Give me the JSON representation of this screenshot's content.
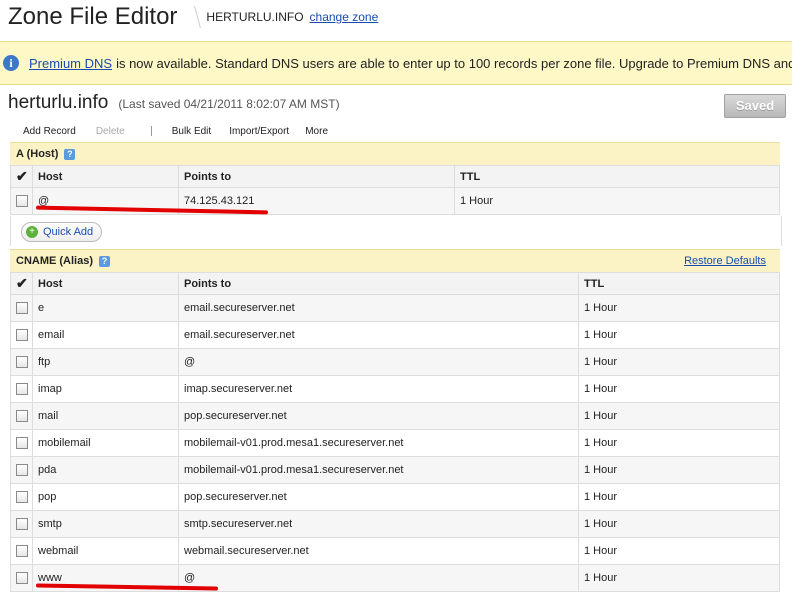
{
  "header": {
    "title": "Zone File Editor",
    "zone": "HERTURLU.INFO",
    "change_zone": "change zone"
  },
  "banner": {
    "link": "Premium DNS",
    "text": "is now available. Standard DNS users are able to enter up to 100 records per zone file. Upgrade to Premium DNS and"
  },
  "domain": {
    "name": "herturlu.info",
    "last_saved": "(Last saved 04/21/2011 8:02:07 AM MST)",
    "saved_button": "Saved"
  },
  "toolbar": {
    "add": "Add Record",
    "delete": "Delete",
    "bulk": "Bulk Edit",
    "import": "Import/Export",
    "more": "More"
  },
  "a_section": {
    "title": "A (Host)",
    "headers": {
      "host": "Host",
      "points": "Points to",
      "ttl": "TTL"
    },
    "rows": [
      {
        "host": "@",
        "points": "74.125.43.121",
        "ttl": "1 Hour"
      }
    ],
    "quick_add": "Quick Add"
  },
  "cname_section": {
    "title": "CNAME (Alias)",
    "restore": "Restore Defaults",
    "headers": {
      "host": "Host",
      "points": "Points to",
      "ttl": "TTL"
    },
    "rows": [
      {
        "host": "e",
        "points": "email.secureserver.net",
        "ttl": "1 Hour"
      },
      {
        "host": "email",
        "points": "email.secureserver.net",
        "ttl": "1 Hour"
      },
      {
        "host": "ftp",
        "points": "@",
        "ttl": "1 Hour"
      },
      {
        "host": "imap",
        "points": "imap.secureserver.net",
        "ttl": "1 Hour"
      },
      {
        "host": "mail",
        "points": "pop.secureserver.net",
        "ttl": "1 Hour"
      },
      {
        "host": "mobilemail",
        "points": "mobilemail-v01.prod.mesa1.secureserver.net",
        "ttl": "1 Hour"
      },
      {
        "host": "pda",
        "points": "mobilemail-v01.prod.mesa1.secureserver.net",
        "ttl": "1 Hour"
      },
      {
        "host": "pop",
        "points": "pop.secureserver.net",
        "ttl": "1 Hour"
      },
      {
        "host": "smtp",
        "points": "smtp.secureserver.net",
        "ttl": "1 Hour"
      },
      {
        "host": "webmail",
        "points": "webmail.secureserver.net",
        "ttl": "1 Hour"
      },
      {
        "host": "www",
        "points": "@",
        "ttl": "1 Hour"
      }
    ]
  },
  "colors": {
    "banner_bg": "#fdf8c6",
    "section_bg": "#fbf3c6",
    "link": "#1a4bb0",
    "annotation": "#e30000"
  }
}
